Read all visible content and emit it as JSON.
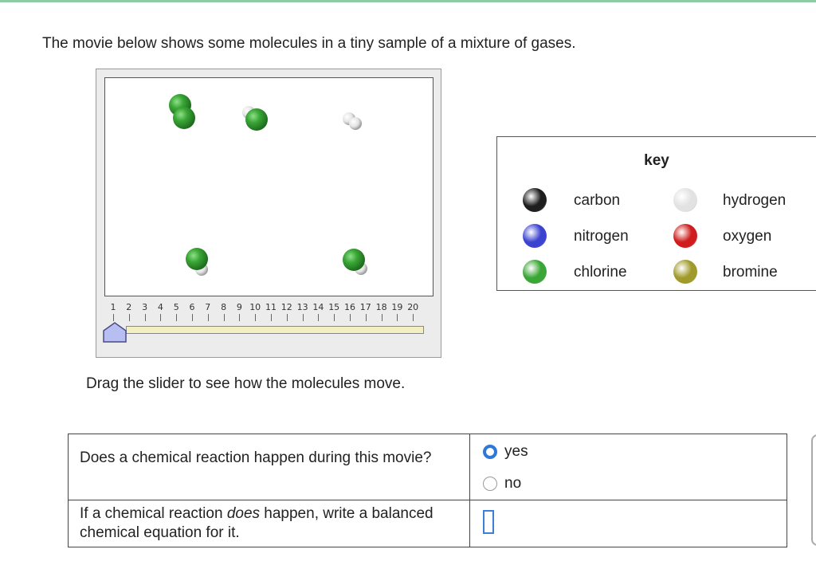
{
  "intro": "The movie below shows some molecules in a tiny sample of a mixture of gases.",
  "movie": {
    "frame_labels": [
      "1",
      "2",
      "3",
      "4",
      "5",
      "6",
      "7",
      "8",
      "9",
      "10",
      "11",
      "12",
      "13",
      "14",
      "15",
      "16",
      "17",
      "18",
      "19",
      "20"
    ],
    "current_frame": 1,
    "caption": "Drag the slider to see how the molecules move."
  },
  "key": {
    "title": "key",
    "items": [
      {
        "label": "carbon",
        "color": "#1e1e1e"
      },
      {
        "label": "hydrogen",
        "color": "#e2e2e2"
      },
      {
        "label": "nitrogen",
        "color": "#3c43d0"
      },
      {
        "label": "oxygen",
        "color": "#d01c1c"
      },
      {
        "label": "chlorine",
        "color": "#3aa636"
      },
      {
        "label": "bromine",
        "color": "#a09a2a"
      }
    ]
  },
  "questions": [
    {
      "text": "Does a chemical reaction happen during this movie?",
      "options": [
        "yes",
        "no"
      ],
      "selected": "yes"
    },
    {
      "text_before": "If a chemical reaction ",
      "text_em": "does",
      "text_after": " happen, write a balanced chemical equation for it.",
      "answer": ""
    }
  ]
}
